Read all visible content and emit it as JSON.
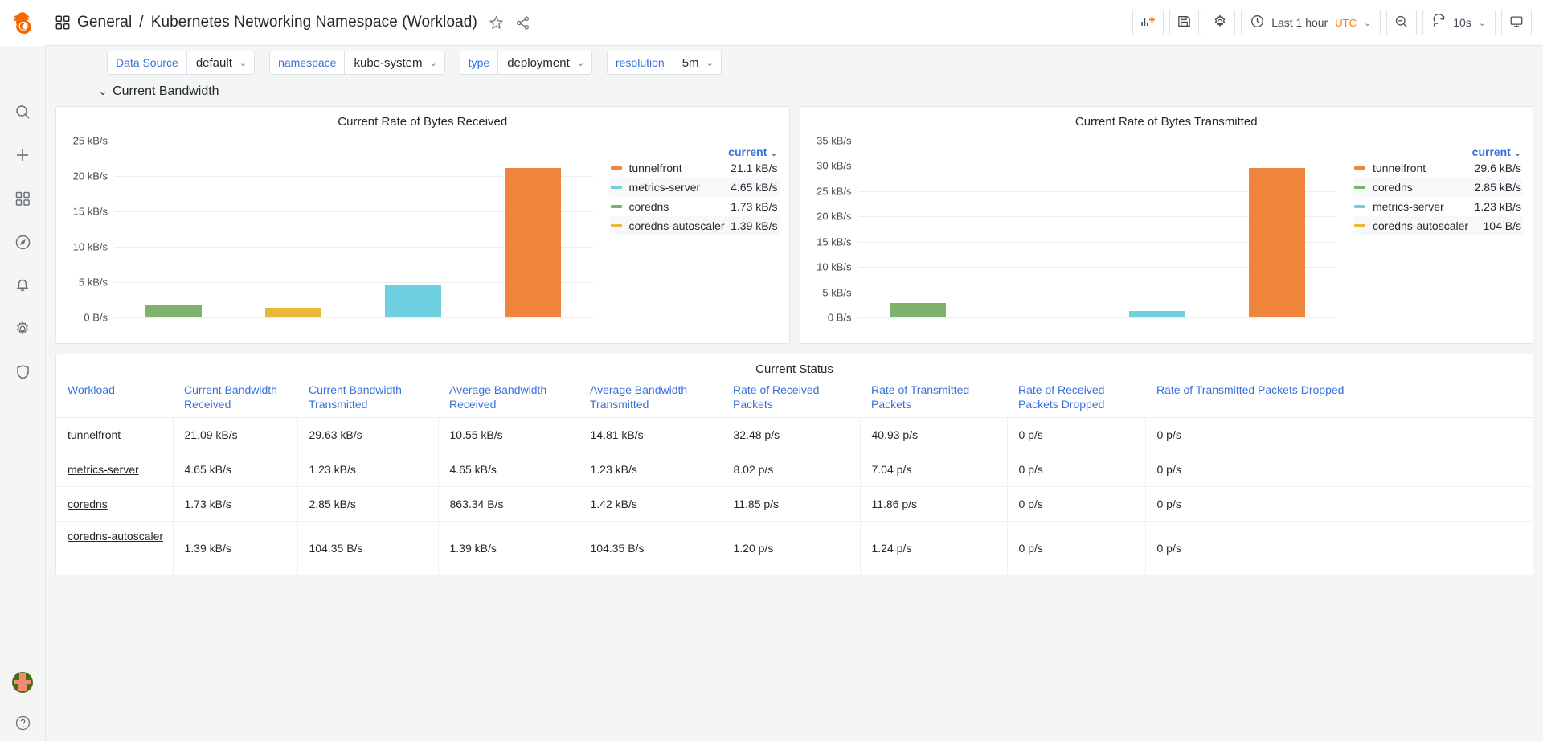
{
  "sidebar": {
    "brand_icon": "grafana-logo-icon",
    "items": [
      {
        "name": "search",
        "icon": "search-icon"
      },
      {
        "name": "create",
        "icon": "plus-icon"
      },
      {
        "name": "dashboards",
        "icon": "apps-grid-icon"
      },
      {
        "name": "explore",
        "icon": "compass-icon"
      },
      {
        "name": "alerting",
        "icon": "bell-icon"
      },
      {
        "name": "configuration",
        "icon": "gear-icon"
      },
      {
        "name": "server-admin",
        "icon": "shield-icon"
      }
    ],
    "bottom": {
      "avatar": "user-avatar",
      "help_label": "?"
    }
  },
  "topnav": {
    "folder": "General",
    "separator": "/",
    "title": "Kubernetes Networking Namespace (Workload)",
    "star_icon": "star-icon",
    "share_icon": "share-icon",
    "actions": {
      "add_panel_label": "add-panel-icon",
      "save_label": "save-dashboard-icon",
      "settings_label": "dashboard-settings-icon",
      "time_range": "Last 1 hour",
      "timezone": "UTC",
      "zoom_out_label": "zoom-out-icon",
      "refresh_label": "refresh-icon",
      "refresh_interval": "10s",
      "tv_label": "cycle-view-mode-icon"
    }
  },
  "variables": [
    {
      "label": "Data Source",
      "value": "default"
    },
    {
      "label": "namespace",
      "value": "kube-system"
    },
    {
      "label": "type",
      "value": "deployment"
    },
    {
      "label": "resolution",
      "value": "5m"
    }
  ],
  "row": {
    "title": "Current Bandwidth",
    "collapsed": false
  },
  "colors": {
    "orange": "#ef843c",
    "green": "#7eb26d",
    "yellow": "#eab839",
    "cyan": "#6ed0e0",
    "link_blue": "#3871dc",
    "accent_orange": "#ff780a"
  },
  "chart_data": [
    {
      "type": "bar",
      "title": "Current Rate of Bytes Received",
      "panel": "received",
      "xlabel": "",
      "ylabel": "",
      "ylim": [
        0,
        25
      ],
      "yunit": "kB/s",
      "grid": true,
      "yticks": [
        "25 kB/s",
        "20 kB/s",
        "15 kB/s",
        "10 kB/s",
        "5 kB/s",
        "0 B/s"
      ],
      "ytick_values": [
        25,
        20,
        15,
        10,
        5,
        0
      ],
      "categories": [
        "coredns",
        "coredns-autoscaler",
        "metrics-server",
        "tunnelfront"
      ],
      "values": [
        1.73,
        1.39,
        4.65,
        21.1
      ],
      "bar_colors": [
        "#7eb26d",
        "#eab839",
        "#6ed0e0",
        "#ef843c"
      ],
      "legend_position": "right",
      "legend_header": "current",
      "legend": [
        {
          "name": "tunnelfront",
          "value": "21.1 kB/s",
          "color": "#ef843c"
        },
        {
          "name": "metrics-server",
          "value": "4.65 kB/s",
          "color": "#6ed0e0"
        },
        {
          "name": "coredns",
          "value": "1.73 kB/s",
          "color": "#7eb26d"
        },
        {
          "name": "coredns-autoscaler",
          "value": "1.39 kB/s",
          "color": "#eab839"
        }
      ]
    },
    {
      "type": "bar",
      "title": "Current Rate of Bytes Transmitted",
      "panel": "transmitted",
      "xlabel": "",
      "ylabel": "",
      "ylim": [
        0,
        35
      ],
      "yunit": "kB/s",
      "grid": true,
      "yticks": [
        "35 kB/s",
        "30 kB/s",
        "25 kB/s",
        "20 kB/s",
        "15 kB/s",
        "10 kB/s",
        "5 kB/s",
        "0 B/s"
      ],
      "ytick_values": [
        35,
        30,
        25,
        20,
        15,
        10,
        5,
        0
      ],
      "categories": [
        "coredns",
        "coredns-autoscaler",
        "metrics-server",
        "tunnelfront"
      ],
      "values": [
        2.85,
        0.104,
        1.23,
        29.6
      ],
      "bar_colors": [
        "#7eb26d",
        "#eab839",
        "#6ed0e0",
        "#ef843c"
      ],
      "legend_position": "right",
      "legend_header": "current",
      "legend": [
        {
          "name": "tunnelfront",
          "value": "29.6 kB/s",
          "color": "#ef843c"
        },
        {
          "name": "coredns",
          "value": "2.85 kB/s",
          "color": "#7eb26d"
        },
        {
          "name": "metrics-server",
          "value": "1.23 kB/s",
          "color": "#6ed0e0"
        },
        {
          "name": "coredns-autoscaler",
          "value": "104 B/s",
          "color": "#eab839"
        }
      ]
    }
  ],
  "status_table": {
    "title": "Current Status",
    "columns": [
      "Workload",
      "Current Bandwidth Received",
      "Current Bandwidth Transmitted",
      "Average Bandwidth Received",
      "Average Bandwidth Transmitted",
      "Rate of Received Packets",
      "Rate of Transmitted Packets",
      "Rate of Received Packets Dropped",
      "Rate of Transmitted Packets Dropped"
    ],
    "rows": [
      {
        "workload": "tunnelfront",
        "cells": [
          "21.09 kB/s",
          "29.63 kB/s",
          "10.55 kB/s",
          "14.81 kB/s",
          "32.48 p/s",
          "40.93 p/s",
          "0 p/s",
          "0 p/s"
        ]
      },
      {
        "workload": "metrics-server",
        "cells": [
          "4.65 kB/s",
          "1.23 kB/s",
          "4.65 kB/s",
          "1.23 kB/s",
          "8.02 p/s",
          "7.04 p/s",
          "0 p/s",
          "0 p/s"
        ]
      },
      {
        "workload": "coredns",
        "cells": [
          "1.73 kB/s",
          "2.85 kB/s",
          "863.34 B/s",
          "1.42 kB/s",
          "11.85 p/s",
          "11.86 p/s",
          "0 p/s",
          "0 p/s"
        ]
      },
      {
        "workload": "coredns-autoscaler",
        "cells": [
          "1.39 kB/s",
          "104.35 B/s",
          "1.39 kB/s",
          "104.35 B/s",
          "1.20 p/s",
          "1.24 p/s",
          "0 p/s",
          "0 p/s"
        ]
      }
    ]
  }
}
